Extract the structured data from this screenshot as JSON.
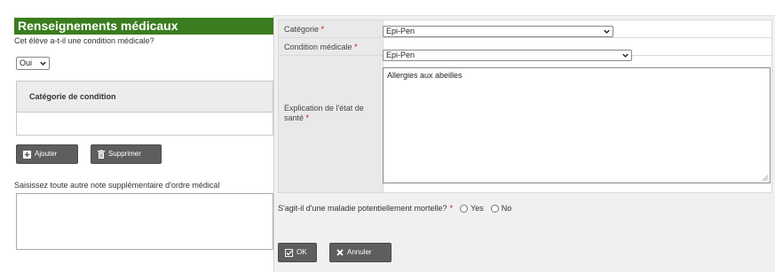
{
  "left": {
    "section_title": "Renseignements médicaux",
    "question": "Cet élève a-t-il une condition médicale?",
    "condition_select_value": "Oui",
    "table_header": "Catégorie de condition",
    "add_button": "Ajouter",
    "delete_button": "Supprimer",
    "note_label": "Saisissez toute autre note supplémentaire d'ordre médical",
    "note_value": ""
  },
  "dialog": {
    "category_label": "Catégorie",
    "category_value": "Epi-Pen",
    "condition_label": "Condition médicale",
    "condition_value": "Epi-Pen",
    "explanation_label": "Explication de l'état de santé",
    "explanation_value": "Allergies aux abeilles",
    "required_marker": "*",
    "mortal_question": "S'agit-il d'une maladie potentiellement mortelle?",
    "radio_yes": "Yes",
    "radio_no": "No",
    "ok_button": "OK",
    "cancel_button": "Annuler"
  },
  "colors": {
    "header_green": "#3a7d1f",
    "button_gray": "#5e5e5e",
    "required_red": "#dd0000"
  }
}
